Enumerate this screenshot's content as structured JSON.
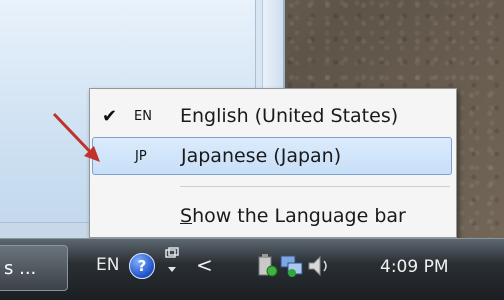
{
  "menu": {
    "items": [
      {
        "check": "✔",
        "abbr": "EN",
        "label": "English (United States)"
      },
      {
        "check": "",
        "abbr": "JP",
        "label": "Japanese (Japan)"
      }
    ],
    "langbar_label_prefix": "S",
    "langbar_label_rest": "how the Language bar"
  },
  "taskbar": {
    "task_button_label": "s ...",
    "language_indicator": "EN",
    "help_glyph": "?",
    "chevron_glyph": "<",
    "clock": "4:09 PM"
  },
  "icons": {
    "help": "help-icon",
    "restore": "restore-icon",
    "chevron": "chevron-left-icon",
    "safely_remove": "safely-remove-hardware-icon",
    "network": "network-icon",
    "volume": "volume-icon"
  }
}
